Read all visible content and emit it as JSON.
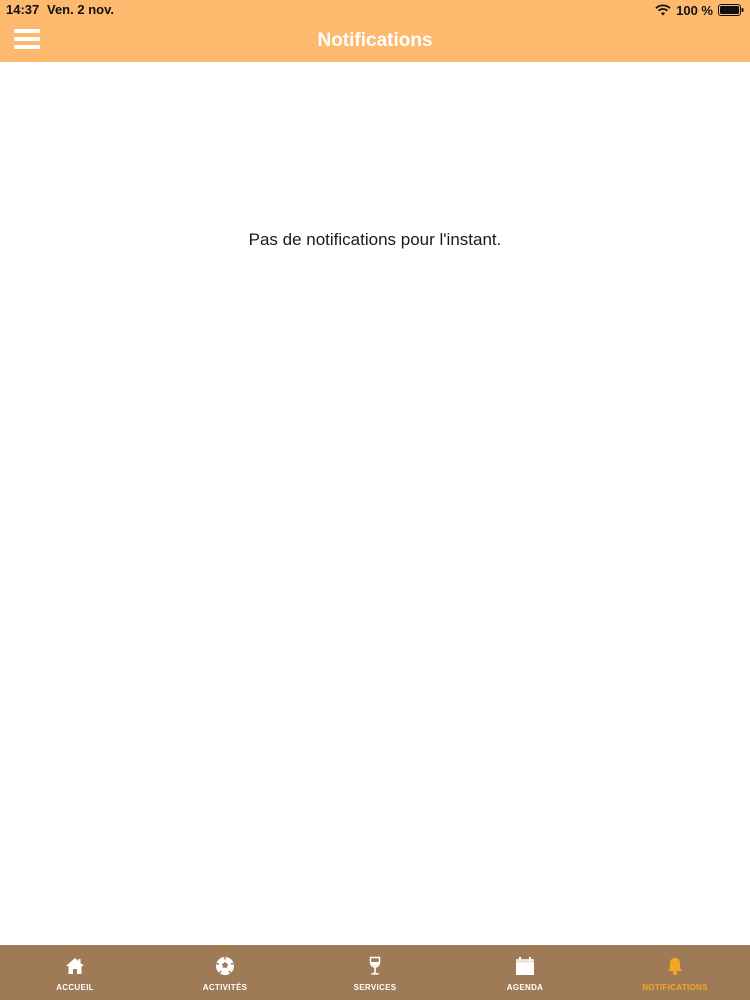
{
  "status_bar": {
    "time": "14:37",
    "date": "Ven. 2 nov.",
    "battery": "100 %"
  },
  "header": {
    "title": "Notifications",
    "menu_icon": "hamburger-menu-icon"
  },
  "main": {
    "empty_message": "Pas de notifications pour l'instant."
  },
  "tabbar": {
    "active_color": "#f5a623",
    "background_color": "#9f7a57",
    "tabs": [
      {
        "label": "ACCUEIL",
        "icon": "home-icon",
        "active": false
      },
      {
        "label": "ACTIVITÉS",
        "icon": "soccer-ball-icon",
        "active": false
      },
      {
        "label": "SERVICES",
        "icon": "wine-glass-icon",
        "active": false
      },
      {
        "label": "AGENDA",
        "icon": "calendar-icon",
        "active": false
      },
      {
        "label": "NOTIFICATIONS",
        "icon": "bell-icon",
        "active": true
      }
    ]
  },
  "colors": {
    "header_background": "#fdb96d",
    "page_background": "#ffffff"
  }
}
